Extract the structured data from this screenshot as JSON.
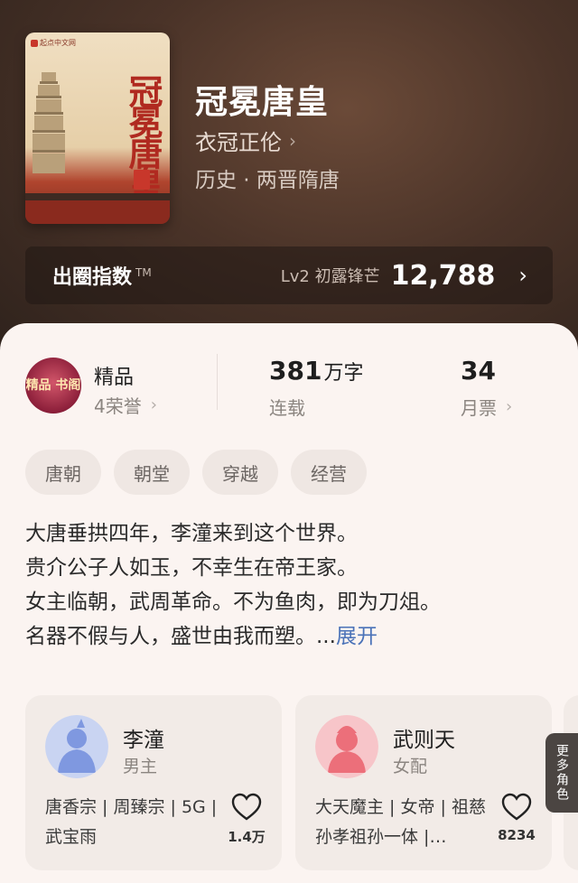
{
  "book": {
    "title": "冠冕唐皇",
    "author": "衣冠正伦",
    "genre": "历史 · 两晋隋唐",
    "cover_title": "冠冕唐皇",
    "cover_publisher": "起点中文网"
  },
  "index_bar": {
    "label": "出圈指数",
    "tm": "TM",
    "level": "Lv2 初露锋芒",
    "value": "12,788"
  },
  "stats": {
    "badge_text": "精品 书阁",
    "honor_label": "精品",
    "honor_sub": "4荣誉",
    "words_num": "381",
    "words_unit": "万字",
    "words_sub": "连载",
    "tickets_num": "34",
    "tickets_sub": "月票"
  },
  "tags": [
    "唐朝",
    "朝堂",
    "穿越",
    "经营"
  ],
  "synopsis": {
    "lines": [
      "大唐垂拱四年，李潼来到这个世界。",
      "贵介公子人如玉，不幸生在帝王家。",
      "女主临朝，武周革命。不为鱼肉，即为刀俎。",
      "名器不假与人，盛世由我而塑。..."
    ],
    "more": "展开"
  },
  "roles": [
    {
      "name": "李潼",
      "type": "男主",
      "desc": "唐香宗 | 周臻宗 | 5G | 武宝雨",
      "likes": "1.4万",
      "avatar_color": "#8ea6e6"
    },
    {
      "name": "武则天",
      "type": "女配",
      "desc": "大天魔主 | 女帝 | 祖慈孙孝祖孙一体 |…",
      "likes": "8234",
      "avatar_color": "#f27c86"
    }
  ],
  "more_roles": "更多角色"
}
